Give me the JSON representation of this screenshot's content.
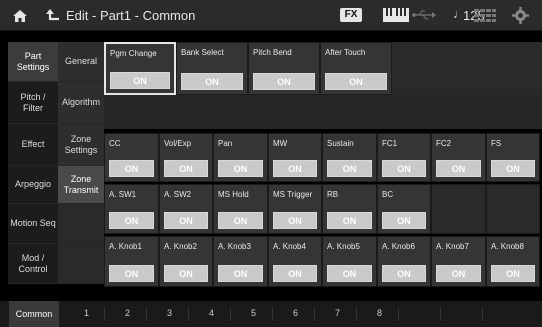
{
  "header": {
    "title": "Edit - Part1 - Common",
    "fx_badge": "FX",
    "tempo_note": "♩",
    "tempo": "125"
  },
  "nav": {
    "primary": [
      {
        "label": "Part Settings",
        "active": true
      },
      {
        "label": "Pitch / Filter",
        "active": false
      },
      {
        "label": "Effect",
        "active": false
      },
      {
        "label": "Arpeggio",
        "active": false
      },
      {
        "label": "Motion Seq",
        "active": false
      },
      {
        "label": "Mod / Control",
        "active": false
      }
    ],
    "secondary": [
      {
        "label": "General",
        "active": false
      },
      {
        "label": "Algorithm",
        "active": false
      },
      {
        "label": "Zone Settings",
        "active": false
      },
      {
        "label": "Zone Transmit",
        "active": true
      },
      {
        "label": "",
        "active": false
      },
      {
        "label": "",
        "active": false
      }
    ]
  },
  "rows": {
    "row1": [
      {
        "label": "Pgm Change",
        "value": "ON",
        "selected": true
      },
      {
        "label": "Bank Select",
        "value": "ON"
      },
      {
        "label": "Pitch Bend",
        "value": "ON"
      },
      {
        "label": "After Touch",
        "value": "ON"
      }
    ],
    "row2": [
      {
        "label": "CC",
        "value": "ON"
      },
      {
        "label": "Vol/Exp",
        "value": "ON"
      },
      {
        "label": "Pan",
        "value": "ON"
      },
      {
        "label": "MW",
        "value": "ON"
      },
      {
        "label": "Sustain",
        "value": "ON"
      },
      {
        "label": "FC1",
        "value": "ON"
      },
      {
        "label": "FC2",
        "value": "ON"
      },
      {
        "label": "FS",
        "value": "ON"
      }
    ],
    "row3": [
      {
        "label": "A. SW1",
        "value": "ON"
      },
      {
        "label": "A. SW2",
        "value": "ON"
      },
      {
        "label": "MS Hold",
        "value": "ON"
      },
      {
        "label": "MS Trigger",
        "value": "ON"
      },
      {
        "label": "RB",
        "value": "ON"
      },
      {
        "label": "BC",
        "value": "ON"
      }
    ],
    "row4": [
      {
        "label": "A. Knob1",
        "value": "ON"
      },
      {
        "label": "A. Knob2",
        "value": "ON"
      },
      {
        "label": "A. Knob3",
        "value": "ON"
      },
      {
        "label": "A. Knob4",
        "value": "ON"
      },
      {
        "label": "A. Knob5",
        "value": "ON"
      },
      {
        "label": "A. Knob6",
        "value": "ON"
      },
      {
        "label": "A. Knob7",
        "value": "ON"
      },
      {
        "label": "A. Knob8",
        "value": "ON"
      }
    ]
  },
  "bottom": {
    "common": "Common",
    "parts": [
      "1",
      "2",
      "3",
      "4",
      "5",
      "6",
      "7",
      "8"
    ]
  },
  "colors": {
    "on_button": "#c9c9c9",
    "cell_bg": "#353535",
    "topbar_bg": "#2b2b2b"
  }
}
